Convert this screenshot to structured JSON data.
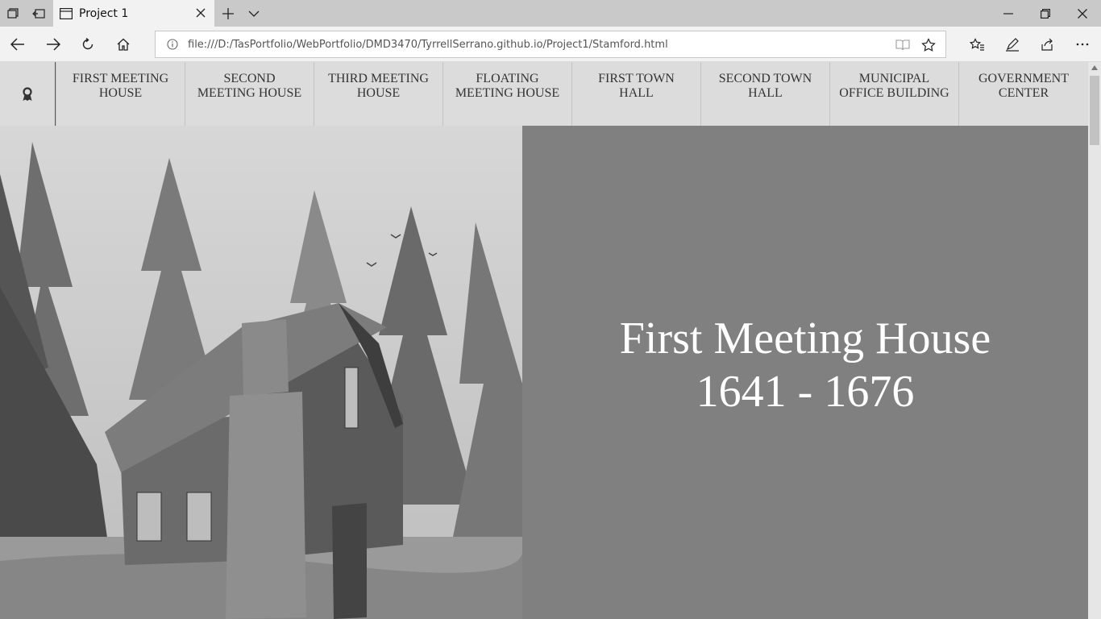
{
  "browser": {
    "tab": {
      "title": "Project 1"
    },
    "address_bar": {
      "url": "file:///D:/TasPortfolio/WebPortfolio/DMD3470/TyrrellSerrano.github.io/Project1/Stamford.html"
    }
  },
  "site": {
    "nav": {
      "logo_icon": "ribbon-icon",
      "items": [
        {
          "line1": "FIRST MEETING",
          "line2": "HOUSE"
        },
        {
          "line1": "SECOND",
          "line2": "MEETING HOUSE"
        },
        {
          "line1": "THIRD MEETING",
          "line2": "HOUSE"
        },
        {
          "line1": "FLOATING",
          "line2": "MEETING HOUSE"
        },
        {
          "line1": "FIRST TOWN",
          "line2": "HALL"
        },
        {
          "line1": "SECOND TOWN",
          "line2": "HALL"
        },
        {
          "line1": "MUNICIPAL",
          "line2": "OFFICE BUILDING"
        },
        {
          "line1": "GOVERNMENT",
          "line2": "CENTER"
        }
      ]
    },
    "hero": {
      "title": "First Meeting House",
      "years": "1641 - 1676"
    },
    "colors": {
      "hero_bg": "#808080",
      "nav_bg": "#dcdcdc"
    }
  }
}
